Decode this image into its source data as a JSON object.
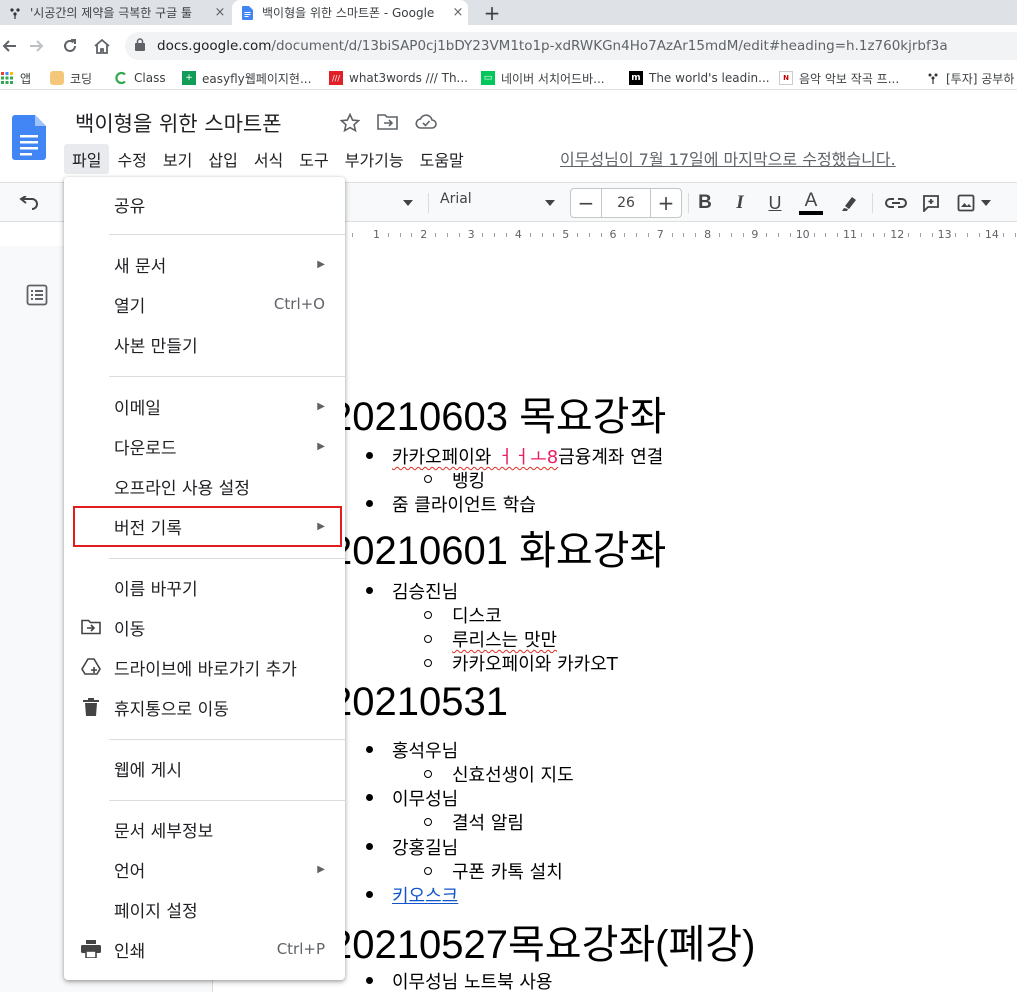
{
  "browser": {
    "tabs": [
      {
        "title": "'시공간의 제약을 극복한 구글 툴",
        "active": false
      },
      {
        "title": "백이형을 위한 스마트폰 - Google",
        "active": true
      }
    ],
    "new_tab_label": "+",
    "close_label": "×",
    "url_host": "docs.google.com",
    "url_path": "/document/d/13biSAP0cj1bDY23VM1to1p-xdRWKGn4Ho7AzAr15mdM/edit#heading=h.1z760kjrbf3a",
    "bookmarks": [
      {
        "label": "앱",
        "icon": "apps-grid-icon"
      },
      {
        "label": "코딩",
        "icon": "dog-icon"
      },
      {
        "label": "Class",
        "icon": "class-icon"
      },
      {
        "label": "easyfly웹페이지현...",
        "icon": "easyfly-icon"
      },
      {
        "label": "what3words /// Th...",
        "icon": "what3words-icon"
      },
      {
        "label": "네이버 서치어드바...",
        "icon": "naver-icon"
      },
      {
        "label": "The world's leadin...",
        "icon": "m-icon"
      },
      {
        "label": "음악 악보 작곡 프...",
        "icon": "noteflight-icon"
      },
      {
        "label": "[투자] 공부하",
        "icon": "investment-icon"
      }
    ]
  },
  "docs": {
    "title": "백이형을 위한 스마트폰",
    "menu": [
      "파일",
      "수정",
      "보기",
      "삽입",
      "서식",
      "도구",
      "부가기능",
      "도움말"
    ],
    "last_edit": "이무성님이 7월 17일에 마지막으로 수정했습니다.",
    "toolbar": {
      "font": "Arial",
      "font_size": "26",
      "minus": "−",
      "plus": "+",
      "bold": "B",
      "italic": "I",
      "underline": "U",
      "text_color": "A"
    },
    "ruler_numbers": [
      "1",
      "2",
      "3",
      "4",
      "5",
      "6",
      "7",
      "8",
      "9",
      "10",
      "11",
      "12",
      "13",
      "14"
    ]
  },
  "file_menu": {
    "items": [
      {
        "label": "공유",
        "icon": "",
        "submenu": false,
        "shortcut": ""
      },
      {
        "label": "새 문서",
        "icon": "",
        "submenu": true,
        "shortcut": ""
      },
      {
        "label": "열기",
        "icon": "",
        "submenu": false,
        "shortcut": "Ctrl+O"
      },
      {
        "label": "사본 만들기",
        "icon": "",
        "submenu": false,
        "shortcut": ""
      },
      {
        "label": "이메일",
        "icon": "",
        "submenu": true,
        "shortcut": ""
      },
      {
        "label": "다운로드",
        "icon": "",
        "submenu": true,
        "shortcut": ""
      },
      {
        "label": "오프라인 사용 설정",
        "icon": "",
        "submenu": false,
        "shortcut": ""
      },
      {
        "label": "버전 기록",
        "icon": "",
        "submenu": true,
        "shortcut": ""
      },
      {
        "label": "이름 바꾸기",
        "icon": "",
        "submenu": false,
        "shortcut": ""
      },
      {
        "label": "이동",
        "icon": "move-folder-icon",
        "submenu": false,
        "shortcut": ""
      },
      {
        "label": "드라이브에 바로가기 추가",
        "icon": "drive-shortcut-icon",
        "submenu": false,
        "shortcut": ""
      },
      {
        "label": "휴지통으로 이동",
        "icon": "trash-icon",
        "submenu": false,
        "shortcut": ""
      },
      {
        "label": "웹에 게시",
        "icon": "",
        "submenu": false,
        "shortcut": ""
      },
      {
        "label": "문서 세부정보",
        "icon": "",
        "submenu": false,
        "shortcut": ""
      },
      {
        "label": "언어",
        "icon": "",
        "submenu": true,
        "shortcut": ""
      },
      {
        "label": "페이지 설정",
        "icon": "",
        "submenu": false,
        "shortcut": ""
      },
      {
        "label": "인쇄",
        "icon": "print-icon",
        "submenu": false,
        "shortcut": "Ctrl+P"
      }
    ],
    "highlight_color": "#e11d1d",
    "highlighted_item": "버전 기록"
  },
  "document": {
    "sections": [
      {
        "heading": "20210603 목요강좌",
        "items": [
          {
            "level": 1,
            "text_before": "카카오페이와 ",
            "text_pink": "ㅓㅓㅗ8",
            "text_after": "금융계좌 연결"
          },
          {
            "level": 2,
            "text": "뱅킹"
          },
          {
            "level": 1,
            "text": "줌 클라이언트 학습"
          }
        ]
      },
      {
        "heading": "20210601 화요강좌",
        "items": [
          {
            "level": 1,
            "text": "김승진님"
          },
          {
            "level": 2,
            "text": "디스코"
          },
          {
            "level": 2,
            "text": "루리스는 맛만"
          },
          {
            "level": 2,
            "text": "카카오페이와 카카오T"
          }
        ]
      },
      {
        "heading": "20210531",
        "items": [
          {
            "level": 1,
            "text": "홍석우님"
          },
          {
            "level": 2,
            "text": "신효선생이 지도"
          },
          {
            "level": 1,
            "text": "이무성님"
          },
          {
            "level": 2,
            "text": "결석 알림"
          },
          {
            "level": 1,
            "text": "강홍길님"
          },
          {
            "level": 2,
            "text": "구폰 카톡 설치"
          },
          {
            "level": 1,
            "text": "키오스크",
            "link": true
          }
        ]
      },
      {
        "heading": "20210527목요강좌(폐강)",
        "items": [
          {
            "level": 1,
            "text": "이무성님 노트북 사용"
          }
        ]
      }
    ]
  },
  "colors": {
    "docs_blue": "#4285f4",
    "link": "#1155cc",
    "pink_text": "#e91e63",
    "highlight_box": "#e11d1d"
  }
}
